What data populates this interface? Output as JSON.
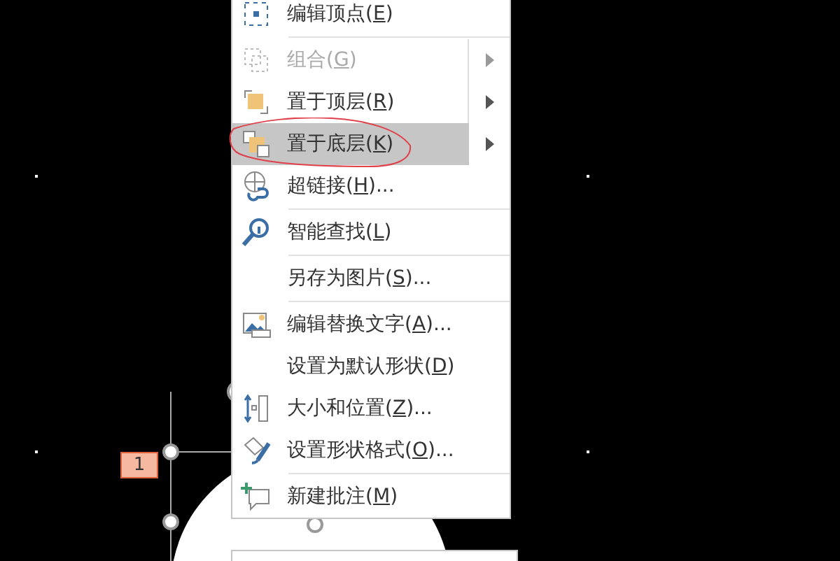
{
  "slide": {
    "badge": "1"
  },
  "context_menu": {
    "items": [
      {
        "label": "编辑顶点(E)",
        "disabled": false,
        "selected": false,
        "submenu": false,
        "separator_after": true
      },
      {
        "label": "组合(G)",
        "disabled": true,
        "selected": false,
        "submenu": true,
        "separator_after": false
      },
      {
        "label": "置于顶层(R)",
        "disabled": false,
        "selected": false,
        "submenu": true,
        "separator_after": false
      },
      {
        "label": "置于底层(K)",
        "disabled": false,
        "selected": true,
        "submenu": true,
        "separator_after": false
      },
      {
        "label": "超链接(H)...",
        "disabled": false,
        "selected": false,
        "submenu": false,
        "separator_after": true
      },
      {
        "label": "智能查找(L)",
        "disabled": false,
        "selected": false,
        "submenu": false,
        "separator_after": true
      },
      {
        "label": "另存为图片(S)...",
        "disabled": false,
        "selected": false,
        "submenu": false,
        "separator_after": true
      },
      {
        "label": "编辑替换文字(A)...",
        "disabled": false,
        "selected": false,
        "submenu": false,
        "separator_after": false
      },
      {
        "label": "设置为默认形状(D)",
        "disabled": false,
        "selected": false,
        "submenu": false,
        "separator_after": false
      },
      {
        "label": "大小和位置(Z)...",
        "disabled": false,
        "selected": false,
        "submenu": false,
        "separator_after": false
      },
      {
        "label": "设置形状格式(O)...",
        "disabled": false,
        "selected": false,
        "submenu": false,
        "separator_after": true
      },
      {
        "label": "新建批注(M)",
        "disabled": false,
        "selected": false,
        "submenu": false,
        "separator_after": false
      }
    ]
  }
}
